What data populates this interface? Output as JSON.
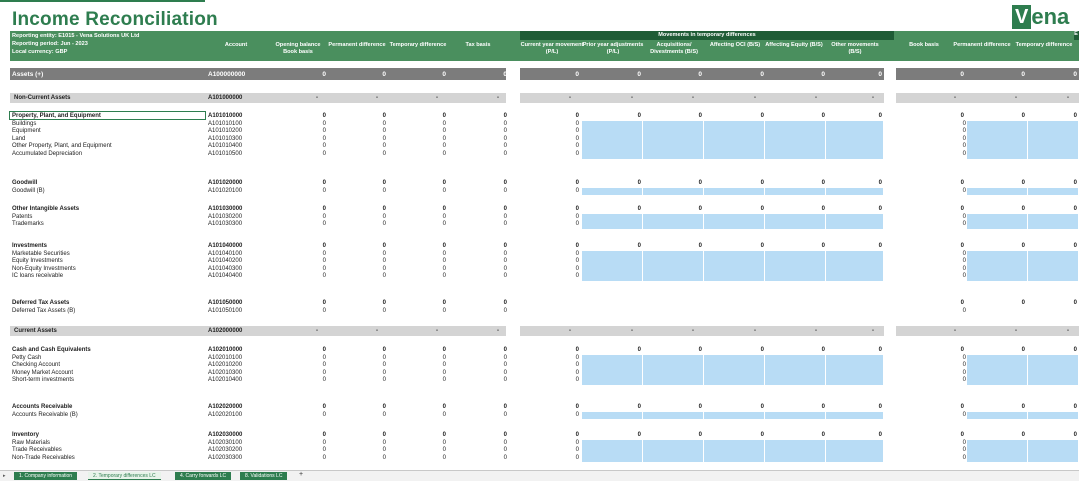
{
  "title": "Income Reconciliation",
  "logo": {
    "mark": "V",
    "rest": "ena"
  },
  "info": {
    "entity": "Reporting entity: E1015 - Vena Solutions UK Ltd",
    "period": "Reporting period: Jun - 2023",
    "currency": "Local currency: GBP"
  },
  "headers": {
    "account": "Account",
    "opening": "Opening balance",
    "opening2": "Book basis",
    "perm": "Permanent difference",
    "temp": "Temporary difference",
    "tax": "Tax basis",
    "movements": "Movements in temporary differences",
    "cy1": "Current year movement",
    "cy2": "(P/L)",
    "py1": "Prior year adjustments",
    "py2": "(P/L)",
    "acq1": "Acquisitions/",
    "acq2": "Divestments (B/S)",
    "oci": "Affecting OCI (B/S)",
    "eq": "Affecting Equity (B/S)",
    "oth1": "Other movements",
    "oth2": "(B/S)",
    "book": "Book basis",
    "perm2": "Permanent difference",
    "temp2": "Temporary difference",
    "e": "E"
  },
  "assets": {
    "label": "Assets (+)",
    "account": "A100000000",
    "value": "0"
  },
  "sections": {
    "noncurrent": {
      "label": "Non-Current Assets",
      "account": "A101000000",
      "dash": "-"
    },
    "current": {
      "label": "Current Assets",
      "account": "A102000000",
      "dash": "-"
    }
  },
  "rows": [
    {
      "label": "Property, Plant, and Equipment",
      "account": "A101010000",
      "bold": true,
      "mov": true
    },
    {
      "label": "Buildings",
      "account": "A101010100"
    },
    {
      "label": "Equipment",
      "account": "A101010200"
    },
    {
      "label": "Land",
      "account": "A101010300"
    },
    {
      "label": "Other Property, Plant, and Equipment",
      "account": "A101010400"
    },
    {
      "label": "Accumulated Depreciation",
      "account": "A101010500"
    },
    {
      "label": "Goodwill",
      "account": "A101020000",
      "bold": true,
      "mov": true
    },
    {
      "label": "Goodwill (B)",
      "account": "A101020100"
    },
    {
      "label": "Other Intangible Assets",
      "account": "A101030000",
      "bold": true,
      "mov": true
    },
    {
      "label": "Patents",
      "account": "A101030200"
    },
    {
      "label": "Trademarks",
      "account": "A101030300"
    },
    {
      "label": "Investments",
      "account": "A101040000",
      "bold": true,
      "mov": true
    },
    {
      "label": "Marketable Securities",
      "account": "A101040100"
    },
    {
      "label": "Equity Investments",
      "account": "A101040200"
    },
    {
      "label": "Non-Equity Investments",
      "account": "A101040300"
    },
    {
      "label": "IC loans receivable",
      "account": "A101040400"
    },
    {
      "label": "Deferred Tax Assets",
      "account": "A101050000",
      "bold": true,
      "nomov": true
    },
    {
      "label": "Deferred Tax Assets (B)",
      "account": "A101050100",
      "nomov": true
    },
    {
      "label": "Cash and Cash Equivalents",
      "account": "A102010000",
      "bold": true,
      "mov": true
    },
    {
      "label": "Petty Cash",
      "account": "A102010100"
    },
    {
      "label": "Checking Account",
      "account": "A102010200"
    },
    {
      "label": "Money Market Account",
      "account": "A102010300"
    },
    {
      "label": "Short-term investments",
      "account": "A102010400"
    },
    {
      "label": "Accounts Receivable",
      "account": "A102020000",
      "bold": true,
      "mov": true
    },
    {
      "label": "Accounts Receivable (B)",
      "account": "A102020100"
    },
    {
      "label": "Inventory",
      "account": "A102030000",
      "bold": true,
      "mov": true
    },
    {
      "label": "Raw Materials",
      "account": "A102030100"
    },
    {
      "label": "Trade Receivables",
      "account": "A102030200"
    },
    {
      "label": "Non-Trade Receivables",
      "account": "A102030300"
    }
  ],
  "zero": "0",
  "tabs": [
    "1. Company information",
    "2. Temporary differences LC",
    "4. Carry forwards LC",
    "8. Validations LC",
    "+"
  ]
}
